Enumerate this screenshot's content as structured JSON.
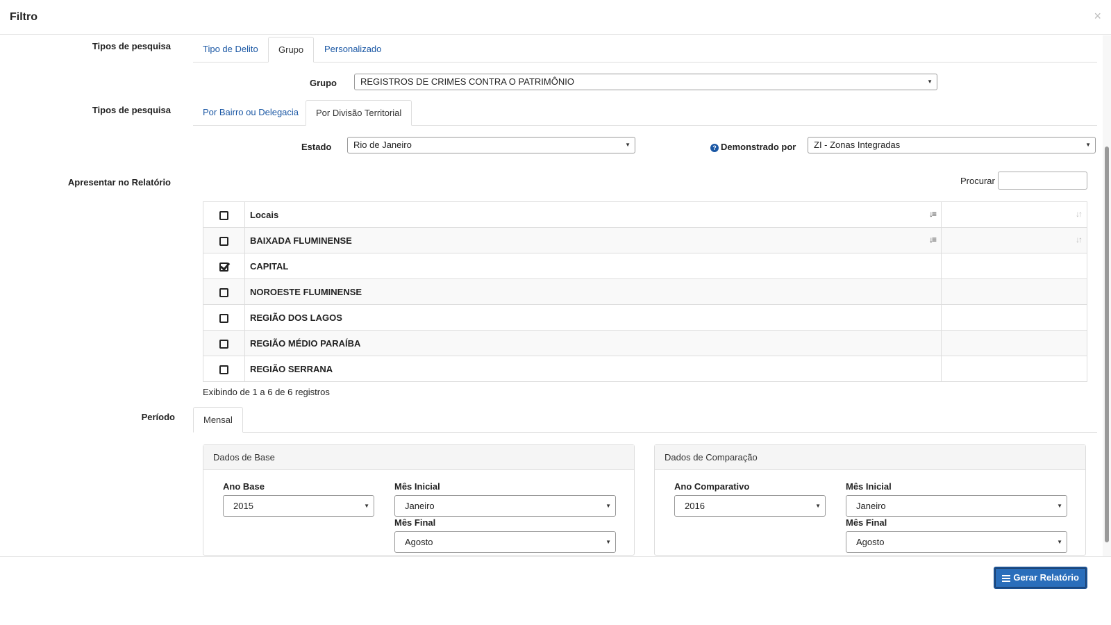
{
  "modal": {
    "title": "Filtro",
    "close": "×"
  },
  "search_types_1": {
    "label": "Tipos de pesquisa",
    "tabs": [
      "Tipo de Delito",
      "Grupo",
      "Personalizado"
    ]
  },
  "grupo": {
    "label": "Grupo",
    "value": "REGISTROS DE CRIMES CONTRA O PATRIMÔNIO"
  },
  "search_types_2": {
    "label": "Tipos de pesquisa",
    "tabs": [
      "Por Bairro ou Delegacia",
      "Por Divisão Territorial"
    ]
  },
  "estado": {
    "label": "Estado",
    "value": "Rio de Janeiro"
  },
  "demonstrado": {
    "label": "Demonstrado por",
    "value": "ZI - Zonas Integradas"
  },
  "relatorio": {
    "label": "Apresentar no Relatório",
    "search_label": "Procurar",
    "search_value": ""
  },
  "table": {
    "header": "Locais",
    "rows": [
      {
        "name": "BAIXADA FLUMINENSE",
        "checked": false
      },
      {
        "name": "CAPITAL",
        "checked": true
      },
      {
        "name": "NOROESTE FLUMINENSE",
        "checked": false
      },
      {
        "name": "REGIÃO DOS LAGOS",
        "checked": false
      },
      {
        "name": "REGIÃO MÉDIO PARAÍBA",
        "checked": false
      },
      {
        "name": "REGIÃO SERRANA",
        "checked": false
      }
    ],
    "info": "Exibindo de 1 a 6 de 6 registros"
  },
  "periodo": {
    "label": "Período",
    "tab": "Mensal"
  },
  "base": {
    "title": "Dados de Base",
    "ano_label": "Ano Base",
    "ano_value": "2015",
    "mes_inicial_label": "Mês Inicial",
    "mes_inicial_value": "Janeiro",
    "mes_final_label": "Mês Final",
    "mes_final_value": "Agosto"
  },
  "comparacao": {
    "title": "Dados de Comparação",
    "ano_label": "Ano Comparativo",
    "ano_value": "2016",
    "mes_inicial_label": "Mês Inicial",
    "mes_inicial_value": "Janeiro",
    "mes_final_label": "Mês Final",
    "mes_final_value": "Agosto"
  },
  "footer": {
    "button": "Gerar Relatório"
  },
  "colors": {
    "link": "#1a57a4",
    "primary": "#2a6ebb"
  }
}
